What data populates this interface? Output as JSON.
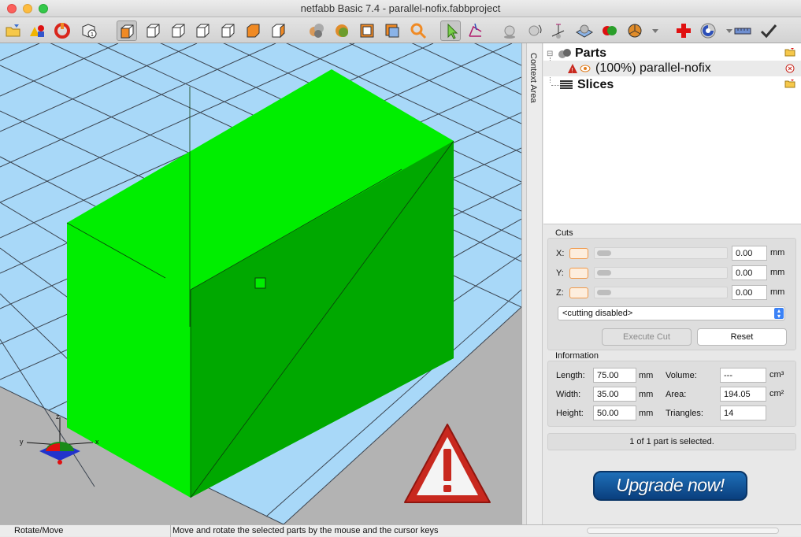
{
  "window": {
    "title": "netfabb Basic 7.4 - parallel-nofix.fabbproject"
  },
  "toolbar": {
    "buttons": [
      "open-folder-icon",
      "add-shapes-icon",
      "repair-icon",
      "part-info-icon",
      "view-iso-icon",
      "view-front-icon",
      "view-back-icon",
      "view-left-icon",
      "view-right-icon",
      "view-top-icon",
      "view-bottom-icon",
      "spheres-icon",
      "sphere-color-icon",
      "box-frame-icon",
      "box-layers-icon",
      "zoom-icon",
      "pointer-icon",
      "move-icon",
      "ball-icon",
      "ball-rotate-icon",
      "axes-icon",
      "platform-icon",
      "color-spheres-icon",
      "pie-sphere-icon",
      "red-cross-icon",
      "sphere-gauge-icon",
      "ruler-icon",
      "checkmark-icon"
    ]
  },
  "context_area": {
    "label": "Context Area"
  },
  "tree": {
    "parts_label": "Parts",
    "part_name": "(100%) parallel-nofix",
    "slices_label": "Slices"
  },
  "cuts": {
    "title": "Cuts",
    "x_label": "X:",
    "y_label": "Y:",
    "z_label": "Z:",
    "x_value": "0.00",
    "y_value": "0.00",
    "z_value": "0.00",
    "unit": "mm",
    "mode": "<cutting disabled>",
    "execute_label": "Execute Cut",
    "reset_label": "Reset"
  },
  "information": {
    "title": "Information",
    "length_label": "Length:",
    "length_value": "75.00",
    "width_label": "Width:",
    "width_value": "35.00",
    "height_label": "Height:",
    "height_value": "50.00",
    "unit": "mm",
    "volume_label": "Volume:",
    "volume_value": "---",
    "volume_unit": "cm³",
    "area_label": "Area:",
    "area_value": "194.05",
    "area_unit": "cm²",
    "triangles_label": "Triangles:",
    "triangles_value": "14"
  },
  "selection_status": "1 of 1 part is selected.",
  "upgrade_label": "Upgrade now!",
  "axes": {
    "x": "x",
    "y": "y",
    "z": "z"
  },
  "status": {
    "mode": "Rotate/Move",
    "message": "Move and rotate the selected parts by the mouse and the cursor keys"
  },
  "colors": {
    "model_light": "#00ee00",
    "model_dark": "#00a800",
    "platform_blue": "#a8d8f8",
    "floor_gray": "#b4b4b4",
    "warning_red": "#c8281e"
  }
}
